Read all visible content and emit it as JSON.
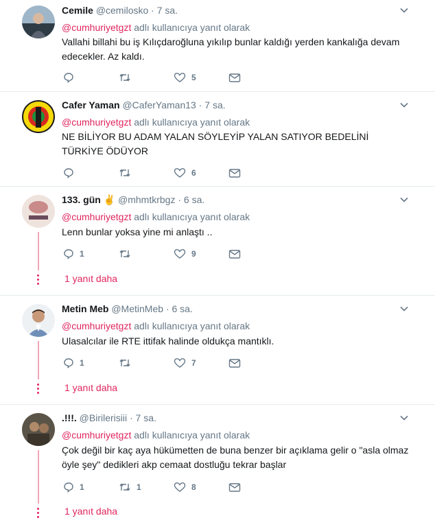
{
  "tweets": [
    {
      "name": "Cemile",
      "handle": "@cemilosko",
      "time": "7 sa.",
      "reply_prefix": "@cumhuriyetgzt",
      "reply_suffix": "adlı kullanıcıya yanıt olarak",
      "text": "Vallahi billahi bu iş Kılıçdaroğluna yıkılıp bunlar kaldığı yerden kankalığa devam edecekler. Az kaldı.",
      "replies": "",
      "retweets": "",
      "likes": "5"
    },
    {
      "name": "Cafer Yaman",
      "handle": "@CaferYaman13",
      "time": "7 sa.",
      "reply_prefix": "@cumhuriyetgzt",
      "reply_suffix": "adlı kullanıcıya yanıt olarak",
      "text": "NE  BİLİYOR BU  ADAM  YALAN  SÖYLEYİP  YALAN SATIYOR BEDELİNİ TÜRKİYE  ÖDÜYOR",
      "replies": "",
      "retweets": "",
      "likes": "6"
    },
    {
      "name": "133. gün",
      "emoji": "✌",
      "handle": "@mhmtkrbgz",
      "time": "6 sa.",
      "reply_prefix": "@cumhuriyetgzt",
      "reply_suffix": "adlı kullanıcıya yanıt olarak",
      "text": "Lenn bunlar yoksa yine mi anlaştı ..",
      "replies": "1",
      "retweets": "",
      "likes": "9",
      "more": "1 yanıt daha"
    },
    {
      "name": "Metin Meb",
      "handle": "@MetinMeb",
      "time": "6 sa.",
      "reply_prefix": "@cumhuriyetgzt",
      "reply_suffix": "adlı kullanıcıya yanıt olarak",
      "text": "Ulasalcılar ile RTE ittifak halinde oldukça mantıklı.",
      "replies": "1",
      "retweets": "",
      "likes": "7",
      "more": "1 yanıt daha"
    },
    {
      "name": ".!!!.",
      "handle": "@Birilerisiii",
      "time": "7 sa.",
      "reply_prefix": "@cumhuriyetgzt",
      "reply_suffix": "adlı kullanıcıya yanıt olarak",
      "text": "Çok değil bir kaç aya hükümetten de buna benzer bir açıklama gelir o \"asla olmaz öyle şey\" dedikleri akp cemaat dostluğu tekrar başlar",
      "replies": "1",
      "retweets": "1",
      "likes": "8",
      "more": "1 yanıt daha"
    }
  ],
  "separator": "·",
  "colors": {
    "accent": "#e0245e",
    "muted": "#657786",
    "text": "#14171a",
    "border": "#e6ecf0"
  },
  "icons": [
    "reply-icon",
    "retweet-icon",
    "heart-icon",
    "message-icon",
    "chevron-down-icon"
  ]
}
